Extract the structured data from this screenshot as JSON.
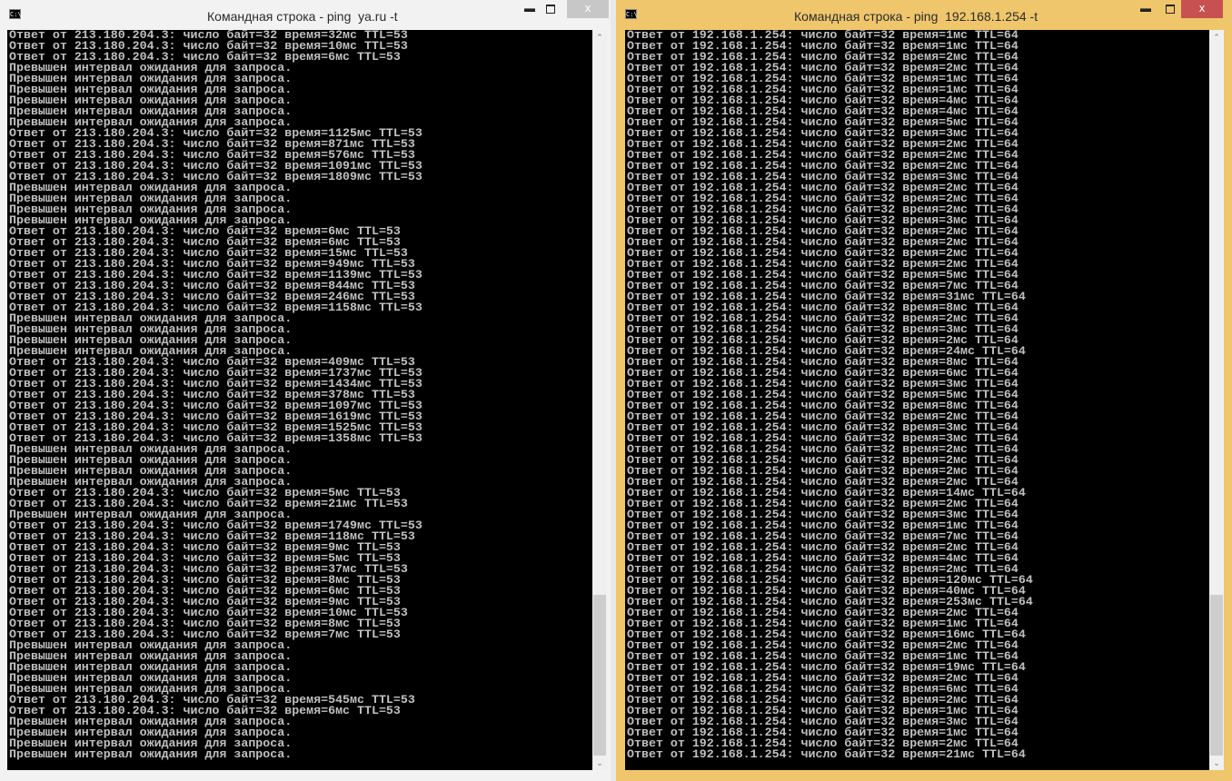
{
  "left_window": {
    "title": "Командная строка - ping  ya.ru -t",
    "icon_label": "C:\\",
    "close_label": "x",
    "lines": [
      "Ответ от 213.180.204.3: число байт=32 время=32мс TTL=53",
      "Ответ от 213.180.204.3: число байт=32 время=10мс TTL=53",
      "Ответ от 213.180.204.3: число байт=32 время=6мс TTL=53",
      "Превышен интервал ожидания для запроса.",
      "Превышен интервал ожидания для запроса.",
      "Превышен интервал ожидания для запроса.",
      "Превышен интервал ожидания для запроса.",
      "Превышен интервал ожидания для запроса.",
      "Превышен интервал ожидания для запроса.",
      "Ответ от 213.180.204.3: число байт=32 время=1125мс TTL=53",
      "Ответ от 213.180.204.3: число байт=32 время=871мс TTL=53",
      "Ответ от 213.180.204.3: число байт=32 время=576мс TTL=53",
      "Ответ от 213.180.204.3: число байт=32 время=1091мс TTL=53",
      "Ответ от 213.180.204.3: число байт=32 время=1809мс TTL=53",
      "Превышен интервал ожидания для запроса.",
      "Превышен интервал ожидания для запроса.",
      "Превышен интервал ожидания для запроса.",
      "Превышен интервал ожидания для запроса.",
      "Ответ от 213.180.204.3: число байт=32 время=6мс TTL=53",
      "Ответ от 213.180.204.3: число байт=32 время=6мс TTL=53",
      "Ответ от 213.180.204.3: число байт=32 время=15мс TTL=53",
      "Ответ от 213.180.204.3: число байт=32 время=949мс TTL=53",
      "Ответ от 213.180.204.3: число байт=32 время=1139мс TTL=53",
      "Ответ от 213.180.204.3: число байт=32 время=844мс TTL=53",
      "Ответ от 213.180.204.3: число байт=32 время=246мс TTL=53",
      "Ответ от 213.180.204.3: число байт=32 время=1158мс TTL=53",
      "Превышен интервал ожидания для запроса.",
      "Превышен интервал ожидания для запроса.",
      "Превышен интервал ожидания для запроса.",
      "Превышен интервал ожидания для запроса.",
      "Ответ от 213.180.204.3: число байт=32 время=409мс TTL=53",
      "Ответ от 213.180.204.3: число байт=32 время=1737мс TTL=53",
      "Ответ от 213.180.204.3: число байт=32 время=1434мс TTL=53",
      "Ответ от 213.180.204.3: число байт=32 время=378мс TTL=53",
      "Ответ от 213.180.204.3: число байт=32 время=1097мс TTL=53",
      "Ответ от 213.180.204.3: число байт=32 время=1619мс TTL=53",
      "Ответ от 213.180.204.3: число байт=32 время=1525мс TTL=53",
      "Ответ от 213.180.204.3: число байт=32 время=1358мс TTL=53",
      "Превышен интервал ожидания для запроса.",
      "Превышен интервал ожидания для запроса.",
      "Превышен интервал ожидания для запроса.",
      "Превышен интервал ожидания для запроса.",
      "Ответ от 213.180.204.3: число байт=32 время=5мс TTL=53",
      "Ответ от 213.180.204.3: число байт=32 время=21мс TTL=53",
      "Превышен интервал ожидания для запроса.",
      "Ответ от 213.180.204.3: число байт=32 время=1749мс TTL=53",
      "Ответ от 213.180.204.3: число байт=32 время=118мс TTL=53",
      "Ответ от 213.180.204.3: число байт=32 время=9мс TTL=53",
      "Ответ от 213.180.204.3: число байт=32 время=5мс TTL=53",
      "Ответ от 213.180.204.3: число байт=32 время=37мс TTL=53",
      "Ответ от 213.180.204.3: число байт=32 время=8мс TTL=53",
      "Ответ от 213.180.204.3: число байт=32 время=6мс TTL=53",
      "Ответ от 213.180.204.3: число байт=32 время=9мс TTL=53",
      "Ответ от 213.180.204.3: число байт=32 время=10мс TTL=53",
      "Ответ от 213.180.204.3: число байт=32 время=8мс TTL=53",
      "Ответ от 213.180.204.3: число байт=32 время=7мс TTL=53",
      "Превышен интервал ожидания для запроса.",
      "Превышен интервал ожидания для запроса.",
      "Превышен интервал ожидания для запроса.",
      "Превышен интервал ожидания для запроса.",
      "Превышен интервал ожидания для запроса.",
      "Ответ от 213.180.204.3: число байт=32 время=545мс TTL=53",
      "Ответ от 213.180.204.3: число байт=32 время=6мс TTL=53",
      "Превышен интервал ожидания для запроса.",
      "Превышен интервал ожидания для запроса.",
      "Превышен интервал ожидания для запроса.",
      "Превышен интервал ожидания для запроса."
    ]
  },
  "right_window": {
    "title": "Командная строка - ping  192.168.1.254 -t",
    "icon_label": "C:\\",
    "close_label": "x",
    "lines": [
      "Ответ от 192.168.1.254: число байт=32 время=1мс TTL=64",
      "Ответ от 192.168.1.254: число байт=32 время=1мс TTL=64",
      "Ответ от 192.168.1.254: число байт=32 время=2мс TTL=64",
      "Ответ от 192.168.1.254: число байт=32 время=2мс TTL=64",
      "Ответ от 192.168.1.254: число байт=32 время=1мс TTL=64",
      "Ответ от 192.168.1.254: число байт=32 время=1мс TTL=64",
      "Ответ от 192.168.1.254: число байт=32 время=4мс TTL=64",
      "Ответ от 192.168.1.254: число байт=32 время=4мс TTL=64",
      "Ответ от 192.168.1.254: число байт=32 время=5мс TTL=64",
      "Ответ от 192.168.1.254: число байт=32 время=3мс TTL=64",
      "Ответ от 192.168.1.254: число байт=32 время=2мс TTL=64",
      "Ответ от 192.168.1.254: число байт=32 время=2мс TTL=64",
      "Ответ от 192.168.1.254: число байт=32 время=2мс TTL=64",
      "Ответ от 192.168.1.254: число байт=32 время=3мс TTL=64",
      "Ответ от 192.168.1.254: число байт=32 время=2мс TTL=64",
      "Ответ от 192.168.1.254: число байт=32 время=2мс TTL=64",
      "Ответ от 192.168.1.254: число байт=32 время=2мс TTL=64",
      "Ответ от 192.168.1.254: число байт=32 время=3мс TTL=64",
      "Ответ от 192.168.1.254: число байт=32 время=2мс TTL=64",
      "Ответ от 192.168.1.254: число байт=32 время=2мс TTL=64",
      "Ответ от 192.168.1.254: число байт=32 время=2мс TTL=64",
      "Ответ от 192.168.1.254: число байт=32 время=2мс TTL=64",
      "Ответ от 192.168.1.254: число байт=32 время=5мс TTL=64",
      "Ответ от 192.168.1.254: число байт=32 время=7мс TTL=64",
      "Ответ от 192.168.1.254: число байт=32 время=31мс TTL=64",
      "Ответ от 192.168.1.254: число байт=32 время=8мс TTL=64",
      "Ответ от 192.168.1.254: число байт=32 время=2мс TTL=64",
      "Ответ от 192.168.1.254: число байт=32 время=3мс TTL=64",
      "Ответ от 192.168.1.254: число байт=32 время=2мс TTL=64",
      "Ответ от 192.168.1.254: число байт=32 время=24мс TTL=64",
      "Ответ от 192.168.1.254: число байт=32 время=8мс TTL=64",
      "Ответ от 192.168.1.254: число байт=32 время=6мс TTL=64",
      "Ответ от 192.168.1.254: число байт=32 время=3мс TTL=64",
      "Ответ от 192.168.1.254: число байт=32 время=5мс TTL=64",
      "Ответ от 192.168.1.254: число байт=32 время=8мс TTL=64",
      "Ответ от 192.168.1.254: число байт=32 время=2мс TTL=64",
      "Ответ от 192.168.1.254: число байт=32 время=3мс TTL=64",
      "Ответ от 192.168.1.254: число байт=32 время=3мс TTL=64",
      "Ответ от 192.168.1.254: число байт=32 время=2мс TTL=64",
      "Ответ от 192.168.1.254: число байт=32 время=2мс TTL=64",
      "Ответ от 192.168.1.254: число байт=32 время=2мс TTL=64",
      "Ответ от 192.168.1.254: число байт=32 время=2мс TTL=64",
      "Ответ от 192.168.1.254: число байт=32 время=14мс TTL=64",
      "Ответ от 192.168.1.254: число байт=32 время=2мс TTL=64",
      "Ответ от 192.168.1.254: число байт=32 время=3мс TTL=64",
      "Ответ от 192.168.1.254: число байт=32 время=1мс TTL=64",
      "Ответ от 192.168.1.254: число байт=32 время=7мс TTL=64",
      "Ответ от 192.168.1.254: число байт=32 время=2мс TTL=64",
      "Ответ от 192.168.1.254: число байт=32 время=4мс TTL=64",
      "Ответ от 192.168.1.254: число байт=32 время=2мс TTL=64",
      "Ответ от 192.168.1.254: число байт=32 время=120мс TTL=64",
      "Ответ от 192.168.1.254: число байт=32 время=40мс TTL=64",
      "Ответ от 192.168.1.254: число байт=32 время=253мс TTL=64",
      "Ответ от 192.168.1.254: число байт=32 время=2мс TTL=64",
      "Ответ от 192.168.1.254: число байт=32 время=1мс TTL=64",
      "Ответ от 192.168.1.254: число байт=32 время=16мс TTL=64",
      "Ответ от 192.168.1.254: число байт=32 время=2мс TTL=64",
      "Ответ от 192.168.1.254: число байт=32 время=1мс TTL=64",
      "Ответ от 192.168.1.254: число байт=32 время=19мс TTL=64",
      "Ответ от 192.168.1.254: число байт=32 время=2мс TTL=64",
      "Ответ от 192.168.1.254: число байт=32 время=6мс TTL=64",
      "Ответ от 192.168.1.254: число байт=32 время=2мс TTL=64",
      "Ответ от 192.168.1.254: число байт=32 время=1мс TTL=64",
      "Ответ от 192.168.1.254: число байт=32 время=3мс TTL=64",
      "Ответ от 192.168.1.254: число байт=32 время=1мс TTL=64",
      "Ответ от 192.168.1.254: число байт=32 время=2мс TTL=64",
      "Ответ от 192.168.1.254: число байт=32 время=21мс TTL=64"
    ]
  },
  "colors": {
    "console_bg": "#000000",
    "console_text": "#c0c0c0",
    "active_border": "#efc66c",
    "inactive_border": "#f2f2f2",
    "close_active": "#c75050"
  }
}
